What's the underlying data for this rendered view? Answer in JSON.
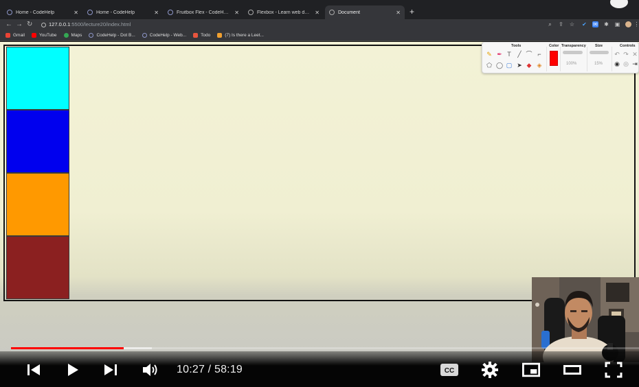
{
  "browser": {
    "tabs": [
      {
        "title": "Home - CodeHelp",
        "active": false
      },
      {
        "title": "Home - CodeHelp",
        "active": false
      },
      {
        "title": "Fruitbox Flex - CodeHelp Labs",
        "active": false
      },
      {
        "title": "Flexbox - Learn web developme",
        "active": false
      },
      {
        "title": "Document",
        "active": true
      }
    ],
    "url_host": "127.0.0.1",
    "url_path": ":5500/lecture20/index.html",
    "bookmarks": [
      "Gmail",
      "YouTube",
      "Maps",
      "CodeHelp - Dot B...",
      "CodeHelp - Web...",
      "Todo",
      "(7) Is there a Leet..."
    ]
  },
  "page": {
    "background": "#f0efd2",
    "boxes": [
      {
        "color": "#00ffff"
      },
      {
        "color": "#0000ee"
      },
      {
        "color": "#ff9900"
      },
      {
        "color": "#8b2020"
      }
    ]
  },
  "annotation_toolbar": {
    "tools_label": "Tools",
    "color_label": "Color",
    "transparency_label": "Transparency",
    "size_label": "Size",
    "controls_label": "Controls",
    "transparency_value": "100%",
    "size_value": "15%",
    "selected_color": "#ff0000"
  },
  "player": {
    "current_time": "10:27",
    "duration": "58:19",
    "time_display": "10:27 / 58:19",
    "played_fraction": 0.179,
    "buffered_fraction": 0.224,
    "progress_color": "#ff0000",
    "cc_label": "CC"
  }
}
